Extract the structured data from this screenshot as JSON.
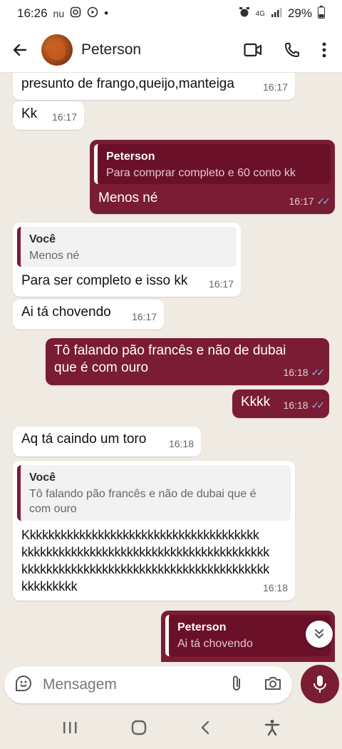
{
  "status_bar": {
    "time": "16:26",
    "left_icons": [
      "nu-icon",
      "instagram-icon",
      "youtube-icon",
      "dot-icon"
    ],
    "battery": "29%",
    "network": "4G"
  },
  "header": {
    "contact_name": "Peterson"
  },
  "messages": [
    {
      "dir": "in",
      "text": "presunto de frango,queijo,manteiga",
      "time": "16:17"
    },
    {
      "dir": "in",
      "text": "Kk",
      "time": "16:17"
    },
    {
      "dir": "out",
      "quote_author": "Peterson",
      "quote_text": "Para comprar completo e 60 conto kk",
      "text": "Menos né",
      "time": "16:17"
    },
    {
      "dir": "in",
      "quote_author": "Você",
      "quote_text": "Menos né",
      "text": "Para ser completo e isso kk",
      "time": "16:17"
    },
    {
      "dir": "in",
      "text": "Ai tá chovendo",
      "time": "16:17"
    },
    {
      "dir": "out",
      "text_line1": "Tô falando pão francês e não de dubai",
      "text_line2": "que é com ouro",
      "time": "16:18"
    },
    {
      "dir": "out",
      "text": "Kkkk",
      "time": "16:18"
    },
    {
      "dir": "in",
      "text": "Aq tá caindo um toro",
      "time": "16:18"
    },
    {
      "dir": "in",
      "quote_author": "Você",
      "quote_text_line1": "Tô falando pão francês e não de dubai que é",
      "quote_text_line2": "com ouro",
      "text_lines": [
        "Kkkkkkkkkkkkkkkkkkkkkkkkkkkkkkkkkkkkkk",
        "kkkkkkkkkkkkkkkkkkkkkkkkkkkkkkkkkkkkkkkk",
        "kkkkkkkkkkkkkkkkkkkkkkkkkkkkkkkkkkkkkkkk",
        "kkkkkkkkk"
      ],
      "time": "16:18"
    },
    {
      "dir": "out",
      "quote_author": "Peterson",
      "quote_text": "Ai tá chovendo"
    }
  ],
  "input": {
    "placeholder": "Mensagem"
  },
  "colors": {
    "outgoing_bubble": "#7a1c34",
    "incoming_bubble": "#ffffff",
    "chat_background": "#efeae2",
    "read_ticks": "#7fb3f0"
  }
}
